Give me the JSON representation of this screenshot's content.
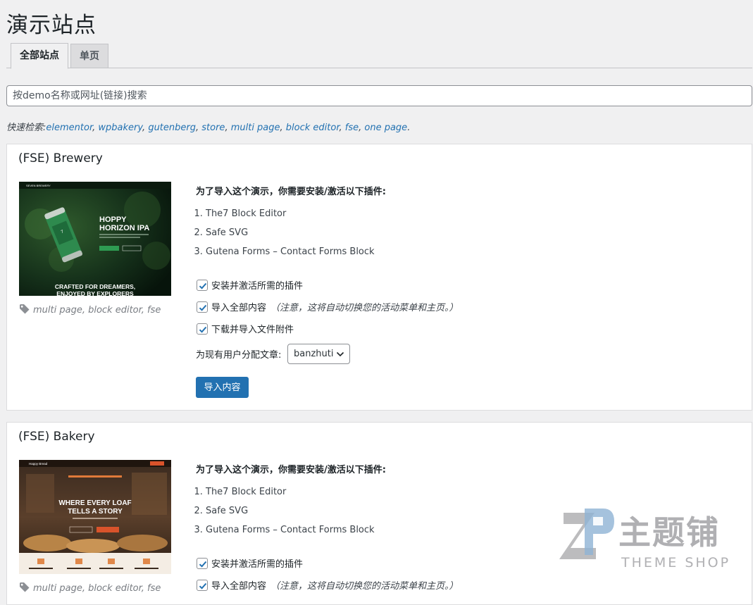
{
  "page": {
    "title": "演示站点"
  },
  "tabs": [
    {
      "label": "全部站点"
    },
    {
      "label": "单页"
    }
  ],
  "search": {
    "placeholder": "按demo名称或网址(链接)搜索"
  },
  "quick_search": {
    "label": "快速检索:",
    "links": [
      "elementor",
      "wpbakery",
      "gutenberg",
      "store",
      "multi page",
      "block editor",
      "fse",
      "one page"
    ],
    "separator": ", ",
    "end": "."
  },
  "demos": [
    {
      "title": "(FSE) Brewery",
      "thumb": {
        "brand": "SEVEN BREWERY",
        "headline_1": "HOPPY",
        "headline_2": "HORIZON IPA",
        "tagline_1": "CRAFTED FOR DREAMERS,",
        "tagline_2": "ENJOYED BY EXPLORERS"
      },
      "tags": "multi page, block editor, fse",
      "requirements_heading": "为了导入这个演示，你需要安装/激活以下插件:",
      "plugins": [
        "The7 Block Editor",
        "Safe SVG",
        "Gutena Forms – Contact Forms Block"
      ],
      "options": [
        {
          "label": "安装并激活所需的插件",
          "checked": true,
          "note": ""
        },
        {
          "label": "导入全部内容",
          "checked": true,
          "note": "（注意，这将自动切换您的活动菜单和主页。）"
        },
        {
          "label": "下载并导入文件附件",
          "checked": true,
          "note": ""
        }
      ],
      "assign_label": "为现有用户分配文章:",
      "assign_value": "banzhuti",
      "import_button": "导入内容"
    },
    {
      "title": "(FSE) Bakery",
      "thumb": {
        "brand": "Happy Bread",
        "headline_1": "WHERE EVERY LOAF",
        "headline_2": "TELLS A STORY"
      },
      "tags": "multi page, block editor, fse",
      "requirements_heading": "为了导入这个演示，你需要安装/激活以下插件:",
      "plugins": [
        "The7 Block Editor",
        "Safe SVG",
        "Gutena Forms – Contact Forms Block"
      ],
      "options": [
        {
          "label": "安装并激活所需的插件",
          "checked": true,
          "note": ""
        },
        {
          "label": "导入全部内容",
          "checked": true,
          "note": "（注意，这将自动切换您的活动菜单和主页。）"
        }
      ]
    }
  ],
  "watermark": {
    "text": "主题铺",
    "sub": "THEME SHOP"
  }
}
